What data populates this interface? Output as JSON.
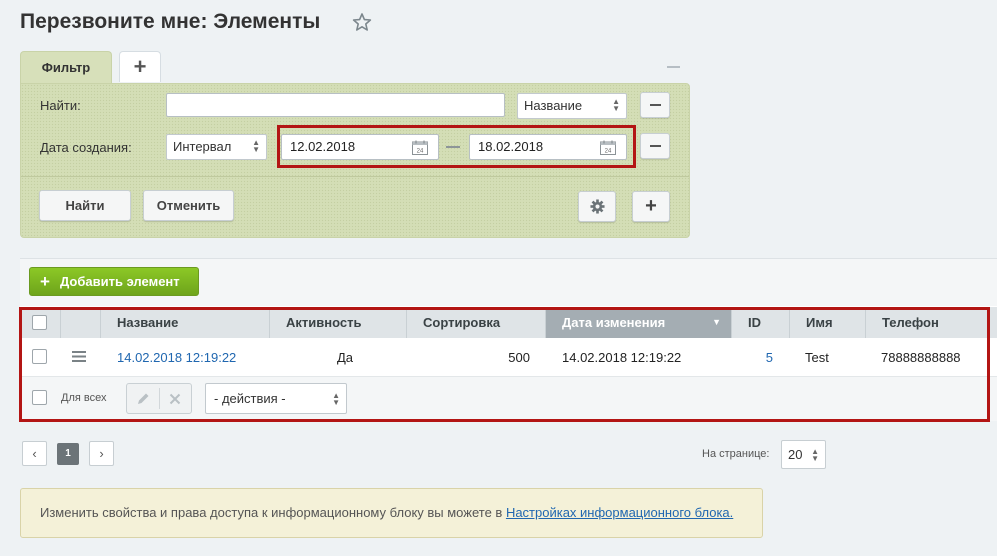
{
  "page": {
    "title": "Перезвоните мне: Элементы"
  },
  "filter": {
    "tab_label": "Фильтр",
    "add_tab_label": "+",
    "find_label": "Найти:",
    "find_value": "",
    "find_field_select": "Название",
    "date_label": "Дата создания:",
    "date_mode": "Интервал",
    "date_from": "12.02.2018",
    "date_to": "18.02.2018",
    "calendar_day": "24",
    "search_button": "Найти",
    "cancel_button": "Отменить",
    "add_field_button": "+"
  },
  "grid": {
    "add_button": "Добавить элемент",
    "columns": [
      "Название",
      "Активность",
      "Сортировка",
      "Дата изменения",
      "ID",
      "Имя",
      "Телефон"
    ],
    "sorted_column": "Дата изменения",
    "rows": [
      {
        "name": "14.02.2018 12:19:22",
        "active": "Да",
        "sort": "500",
        "modified": "14.02.2018 12:19:22",
        "id": "5",
        "first_name": "Test",
        "phone": "78888888888"
      }
    ],
    "footer": {
      "for_all_label": "Для всех",
      "actions_select": "- действия -"
    }
  },
  "pagination": {
    "prev": "‹",
    "current_page": "1",
    "next": "›",
    "per_page_label": "На странице:",
    "per_page_value": "20"
  },
  "notice": {
    "text": "Изменить свойства и права доступа к информационному блоку вы можете в ",
    "link": "Настройках информационного блока."
  },
  "colors": {
    "filter_bg": "#d4deb6",
    "accent_green": "#7cb51f",
    "highlight_red": "#b31514",
    "link_blue": "#2067b0"
  }
}
